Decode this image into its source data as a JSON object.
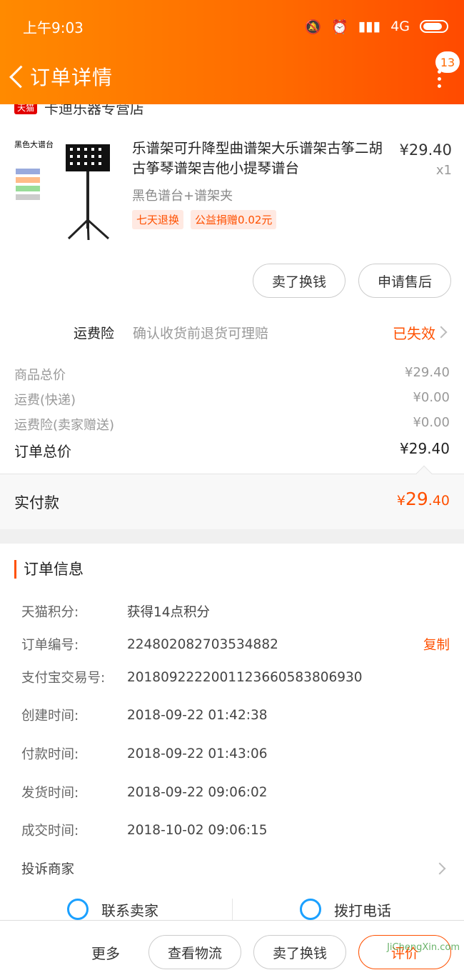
{
  "status_bar": {
    "time": "上午9:03",
    "network": "4G"
  },
  "nav": {
    "title": "订单详情",
    "badge_count": "13"
  },
  "shop": {
    "tag": "天猫",
    "name": "卡迪乐器专营店"
  },
  "product": {
    "image_label": "黑色大谱台",
    "title": "乐谱架可升降型曲谱架大乐谱架古筝二胡古筝琴谱架吉他小提琴谱台",
    "price": "¥29.40",
    "quantity": "x1",
    "sku": "黑色谱台+谱架夹",
    "tags": [
      "七天退换",
      "公益捐赠0.02元"
    ]
  },
  "product_actions": {
    "sell": "卖了换钱",
    "after_sale": "申请售后"
  },
  "insurance": {
    "label": "运费险",
    "desc": "确认收货前退货可理赔",
    "status": "已失效"
  },
  "fees": [
    {
      "label": "商品总价",
      "value": "¥29.40"
    },
    {
      "label": "运费(快递)",
      "value": "¥0.00"
    },
    {
      "label": "运费险(卖家赠送)",
      "value": "¥0.00"
    }
  ],
  "order_total": {
    "label": "订单总价",
    "value": "¥29.40"
  },
  "paid": {
    "label": "实付款",
    "currency": "¥",
    "integer": "29",
    "decimal": ".40"
  },
  "order_info": {
    "title": "订单信息",
    "rows": [
      {
        "key": "天猫积分:",
        "value": "获得14点积分"
      },
      {
        "key": "订单编号:",
        "value": "224802082703534882"
      },
      {
        "key": "支付宝交易号:",
        "value": "2018092222001123660583806930"
      },
      {
        "key": "创建时间:",
        "value": "2018-09-22 01:42:38"
      },
      {
        "key": "付款时间:",
        "value": "2018-09-22 01:43:06"
      },
      {
        "key": "发货时间:",
        "value": "2018-09-22 09:06:02"
      },
      {
        "key": "成交时间:",
        "value": "2018-10-02 09:06:15"
      }
    ],
    "copy_label": "复制",
    "complain": "投诉商家"
  },
  "contact": {
    "seller": "联系卖家",
    "phone": "拨打电话"
  },
  "bottom_bar": {
    "more": "更多",
    "logistics": "查看物流",
    "sell": "卖了换钱",
    "review": "评价"
  },
  "watermark": "JiChengXin.com",
  "colors": {
    "accent": "#ff5000",
    "header": "#ff6a00"
  }
}
